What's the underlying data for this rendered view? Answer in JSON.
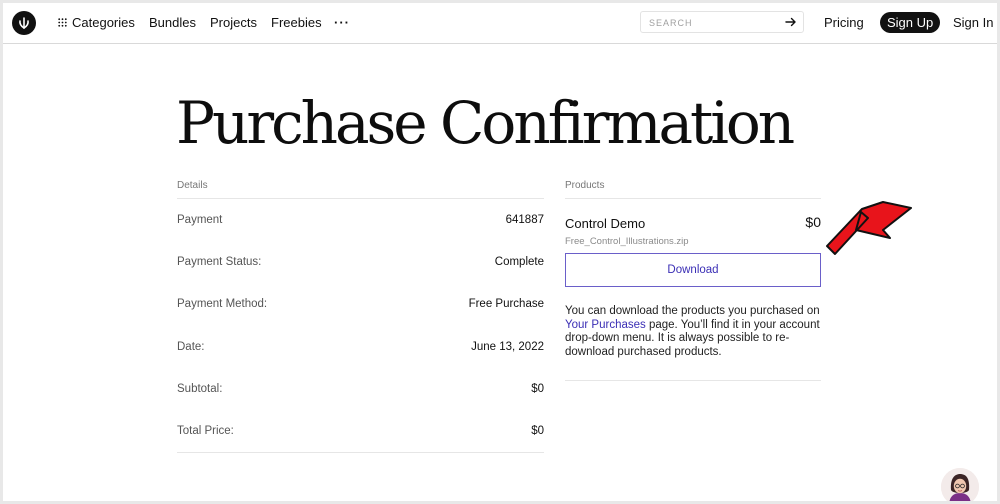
{
  "header": {
    "nav": [
      "Categories",
      "Bundles",
      "Projects",
      "Freebies"
    ],
    "search_placeholder": "SEARCH",
    "pricing": "Pricing",
    "sign_up": "Sign Up",
    "sign_in": "Sign In"
  },
  "page_title": "Purchase Confirmation",
  "details": {
    "heading": "Details",
    "rows": [
      {
        "label": "Payment",
        "value": "641887"
      },
      {
        "label": "Payment Status:",
        "value": "Complete"
      },
      {
        "label": "Payment Method:",
        "value": "Free Purchase"
      },
      {
        "label": "Date:",
        "value": "June 13, 2022"
      },
      {
        "label": "Subtotal:",
        "value": "$0"
      },
      {
        "label": "Total Price:",
        "value": "$0"
      }
    ]
  },
  "products": {
    "heading": "Products",
    "name": "Control Demo",
    "price": "$0",
    "file": "Free_Control_Illustrations.zip",
    "download_label": "Download",
    "info_before": "You can download the products you purchased on ",
    "info_link": "Your Purchases",
    "info_after": " page. You’ll find it in your account drop-down menu. It is always possible to re-download purchased products."
  },
  "colors": {
    "accent": "#3b2fb5",
    "annotation_arrow": "#e8141b"
  }
}
